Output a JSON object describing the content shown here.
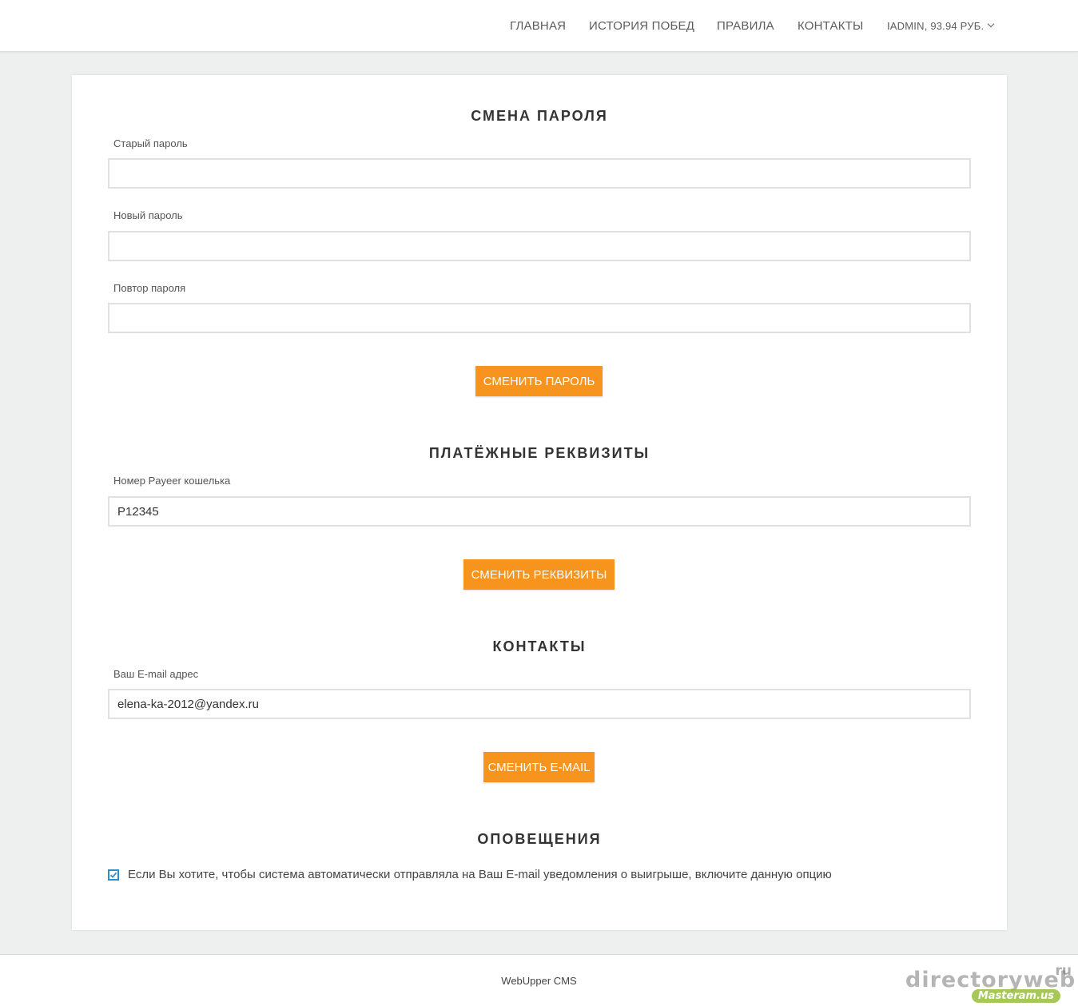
{
  "nav": {
    "home": "ГЛАВНАЯ",
    "history": "ИСТОРИЯ ПОБЕД",
    "rules": "ПРАВИЛА",
    "contacts": "КОНТАКТЫ",
    "user": "IADMIN, 93.94 РУБ."
  },
  "password_section": {
    "title": "СМЕНА ПАРОЛЯ",
    "old_label": "Старый пароль",
    "old_value": "",
    "new_label": "Новый пароль",
    "new_value": "",
    "repeat_label": "Повтор пароля",
    "repeat_value": "",
    "button": "СМЕНИТЬ ПАРОЛЬ"
  },
  "payment_section": {
    "title": "ПЛАТЁЖНЫЕ РЕКВИЗИТЫ",
    "wallet_label": "Номер Payeer кошелька",
    "wallet_value": "P12345",
    "button": "СМЕНИТЬ РЕКВИЗИТЫ"
  },
  "contacts_section": {
    "title": "КОНТАКТЫ",
    "email_label": "Ваш E-mail адрес",
    "email_value": "elena-ka-2012@yandex.ru",
    "button": "СМЕНИТЬ E-MAIL"
  },
  "notifications_section": {
    "title": "ОПОВЕЩЕНИЯ",
    "checkbox_label": "Если Вы хотите, чтобы система автоматически отправляла на Ваш E-mail уведомления о выигрыше, включите данную опцию",
    "checked": true
  },
  "footer": {
    "text": "WebUpper CMS"
  },
  "watermark": {
    "site": "directoryweb",
    "tld": "ru",
    "badge": "Masteram.us"
  },
  "colors": {
    "accent": "#f7941d",
    "checkbox": "#2a8fcf",
    "page_bg": "#eef0ef"
  },
  "icons": {
    "user_menu": "chevron-down-icon",
    "checkbox": "checkmark-icon"
  }
}
